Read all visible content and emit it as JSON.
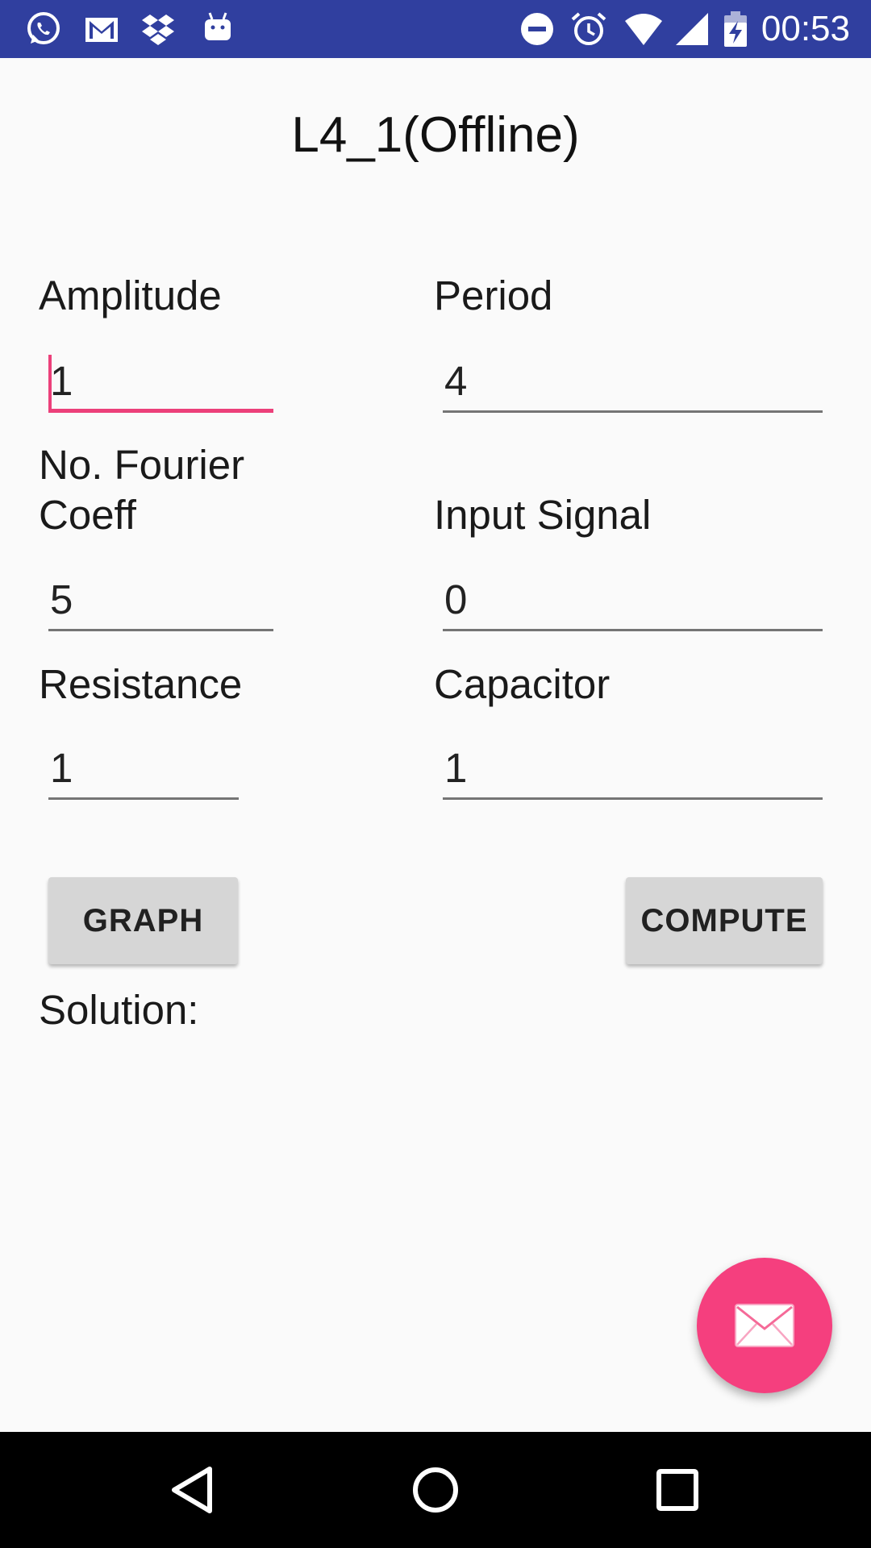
{
  "status_bar": {
    "time": "00:53",
    "left_icons": [
      "whatsapp-icon",
      "gmail-icon",
      "dropbox-icon",
      "android-icon"
    ],
    "right_icons": [
      "do-not-disturb-icon",
      "alarm-icon",
      "wifi-icon",
      "signal-icon",
      "battery-charging-icon"
    ],
    "background": "#303f9f"
  },
  "title": "L4_1(Offline)",
  "form": {
    "amplitude": {
      "label": "Amplitude",
      "value": "1"
    },
    "period": {
      "label": "Period",
      "value": "4"
    },
    "fourier": {
      "label_line1": "No. Fourier",
      "label_line2": "Coeff",
      "value": "5"
    },
    "input_signal": {
      "label": "Input Signal",
      "value": "0"
    },
    "resistance": {
      "label": "Resistance",
      "value": "1"
    },
    "capacitor": {
      "label": "Capacitor",
      "value": "1"
    }
  },
  "buttons": {
    "graph": "GRAPH",
    "compute": "COMPUTE"
  },
  "solution_label": "Solution:",
  "fab": {
    "icon": "email-icon",
    "color": "#f53f7e"
  },
  "nav_bar": {
    "icons": [
      "back-icon",
      "home-icon",
      "recents-icon"
    ]
  },
  "colors": {
    "accent": "#ec407a",
    "primary_dark": "#303f9f"
  }
}
